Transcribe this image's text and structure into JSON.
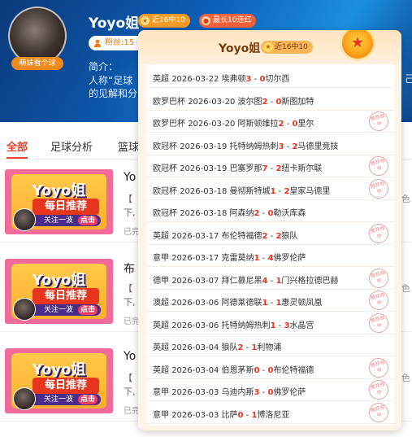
{
  "profile": {
    "name": "Yoyo姐",
    "avatar_tag": "萌妹看个球",
    "badge_hit": "近16中10",
    "badge_streak": "最长10连红",
    "fans_label": "粉丝:15",
    "intro_title": "简介：",
    "intro_line1": "人称“足球",
    "intro_line2": "的见解和分",
    "intro_right": "己"
  },
  "tabs": [
    {
      "label": "全部",
      "active": true
    },
    {
      "label": "足球分析",
      "active": false
    },
    {
      "label": "篮球",
      "active": false
    }
  ],
  "articles": [
    {
      "title": "Yo",
      "desc1": "【",
      "desc2": "下,",
      "meta": "已完",
      "right": "色",
      "thumb": {
        "t1": "Yoyo姐",
        "t2": "每日推荐",
        "t3": "关注一波",
        "t3b": "点击"
      }
    },
    {
      "title": "布",
      "desc1": "【",
      "desc2": "下,",
      "meta": "已完",
      "right": "色",
      "thumb": {
        "t1": "Yoyo姐",
        "t2": "每日推荐",
        "t3": "关注一波",
        "t3b": "点击"
      }
    },
    {
      "title": "Yo",
      "desc1": "【",
      "desc2": "下,",
      "meta": "已完",
      "right": "色",
      "thumb": {
        "t1": "Yoyo姐",
        "t2": "每日推荐",
        "t3": "关注一波",
        "t3b": "点击"
      }
    }
  ],
  "popup": {
    "name": "Yoyo姐",
    "badge": "近16中10",
    "stamp_text": "推荐命中",
    "records": [
      {
        "league": "英超",
        "date": "2026-03-22",
        "home": "埃弗顿",
        "hs": "3",
        "as": "0",
        "away": "切尔西",
        "hit": false
      },
      {
        "league": "欧罗巴杯",
        "date": "2026-03-20",
        "home": "波尔图",
        "hs": "2",
        "as": "0",
        "away": "斯图加特",
        "hit": false
      },
      {
        "league": "欧罗巴杯",
        "date": "2026-03-20",
        "home": "阿斯顿维拉",
        "hs": "2",
        "as": "0",
        "away": "里尔",
        "hit": true
      },
      {
        "league": "欧冠杯",
        "date": "2026-03-19",
        "home": "托特纳姆热刺",
        "hs": "3",
        "as": "2",
        "away": "马德里竞技",
        "hit": false
      },
      {
        "league": "欧冠杯",
        "date": "2026-03-19",
        "home": "巴塞罗那",
        "hs": "7",
        "as": "2",
        "away": "纽卡斯尔联",
        "hit": true
      },
      {
        "league": "欧冠杯",
        "date": "2026-03-18",
        "home": "曼彻斯特城",
        "hs": "1",
        "as": "2",
        "away": "皇家马德里",
        "hit": true
      },
      {
        "league": "欧冠杯",
        "date": "2026-03-18",
        "home": "阿森纳",
        "hs": "2",
        "as": "0",
        "away": "勒沃库森",
        "hit": false
      },
      {
        "league": "英超",
        "date": "2026-03-17",
        "home": "布伦特福德",
        "hs": "2",
        "as": "2",
        "away": "狼队",
        "hit": true
      },
      {
        "league": "意甲",
        "date": "2026-03-17",
        "home": "克雷莫纳",
        "hs": "1",
        "as": "4",
        "away": "佛罗伦萨",
        "hit": false
      },
      {
        "league": "德甲",
        "date": "2026-03-07",
        "home": "拜仁慕尼黑",
        "hs": "4",
        "as": "1",
        "away": "门兴格拉德巴赫",
        "hit": true
      },
      {
        "league": "澳超",
        "date": "2026-03-06",
        "home": "阿德莱德联",
        "hs": "1",
        "as": "1",
        "away": "惠灵顿凤凰",
        "hit": true
      },
      {
        "league": "英超",
        "date": "2026-03-06",
        "home": "托特纳姆热刺",
        "hs": "1",
        "as": "3",
        "away": "水晶宫",
        "hit": true
      },
      {
        "league": "英超",
        "date": "2026-03-04",
        "home": "狼队",
        "hs": "2",
        "as": "1",
        "away": "利物浦",
        "hit": false
      },
      {
        "league": "英超",
        "date": "2026-03-04",
        "home": "伯恩茅斯",
        "hs": "0",
        "as": "0",
        "away": "布伦特福德",
        "hit": true
      },
      {
        "league": "意甲",
        "date": "2026-03-03",
        "home": "乌迪内斯",
        "hs": "3",
        "as": "0",
        "away": "佛罗伦萨",
        "hit": true
      },
      {
        "league": "意甲",
        "date": "2026-03-03",
        "home": "比萨",
        "hs": "0",
        "as": "1",
        "away": "博洛尼亚",
        "hit": true
      }
    ]
  },
  "colors": {
    "accent": "#e8361e",
    "brand_orange": "#f59a22",
    "hero_blue": "#0d5fb8"
  }
}
